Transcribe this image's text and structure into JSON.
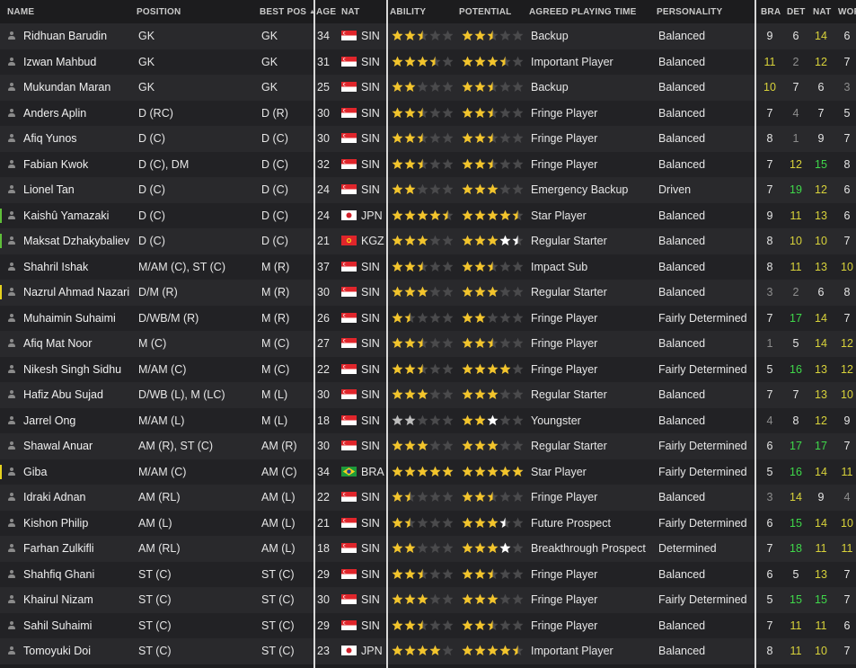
{
  "headers": {
    "name": "NAME",
    "position": "POSITION",
    "best_pos": "BEST POS",
    "age": "AGE",
    "nat": "NAT",
    "ability": "ABILITY",
    "potential": "POTENTIAL",
    "agreed_playing_time": "AGREED PLAYING TIME",
    "personality": "PERSONALITY",
    "bra": "BRA",
    "det": "DET",
    "nat_attr": "NAT",
    "wor": "WOR"
  },
  "colors": {
    "star_gold": "#f2c42c",
    "star_white": "#ffffff",
    "star_silver": "#bdbdbd",
    "star_empty": "#4a4a4c",
    "attr_default": "#e6e6e6",
    "attr_low": "#8e8e8e",
    "attr_mid": "#d8d23a",
    "attr_high": "#3fd84a",
    "marker_green": "#5fbf3a",
    "marker_yellow": "#e6d21e"
  },
  "players": [
    {
      "name": "Ridhuan Barudin",
      "position": "GK",
      "best_pos": "GK",
      "age": "34",
      "nat": "SIN",
      "ability": 2.5,
      "ability_color": "gold",
      "potential": 2.5,
      "potential_color": "gold",
      "time": "Backup",
      "personality": "Balanced",
      "attrs": [
        "9",
        "6",
        "14",
        "6"
      ],
      "attr_tone": [
        "n",
        "n",
        "m",
        "n"
      ],
      "marker": ""
    },
    {
      "name": "Izwan Mahbud",
      "position": "GK",
      "best_pos": "GK",
      "age": "31",
      "nat": "SIN",
      "ability": 3.5,
      "ability_color": "gold",
      "potential": 3.5,
      "potential_color": "gold",
      "time": "Important Player",
      "personality": "Balanced",
      "attrs": [
        "11",
        "2",
        "12",
        "7"
      ],
      "attr_tone": [
        "m",
        "l",
        "m",
        "n"
      ],
      "marker": ""
    },
    {
      "name": "Mukundan Maran",
      "position": "GK",
      "best_pos": "GK",
      "age": "25",
      "nat": "SIN",
      "ability": 2,
      "ability_color": "gold",
      "potential": 2.5,
      "potential_color": "gold",
      "time": "Backup",
      "personality": "Balanced",
      "attrs": [
        "10",
        "7",
        "6",
        "3"
      ],
      "attr_tone": [
        "m",
        "n",
        "n",
        "l"
      ],
      "marker": ""
    },
    {
      "name": "Anders Aplin",
      "position": "D (RC)",
      "best_pos": "D (R)",
      "age": "30",
      "nat": "SIN",
      "ability": 2.5,
      "ability_color": "gold",
      "potential": 2.5,
      "potential_color": "gold",
      "time": "Fringe Player",
      "personality": "Balanced",
      "attrs": [
        "7",
        "4",
        "7",
        "5"
      ],
      "attr_tone": [
        "n",
        "l",
        "n",
        "n"
      ],
      "marker": ""
    },
    {
      "name": "Afiq Yunos",
      "position": "D (C)",
      "best_pos": "D (C)",
      "age": "30",
      "nat": "SIN",
      "ability": 2.5,
      "ability_color": "gold",
      "potential": 2.5,
      "potential_color": "gold",
      "time": "Fringe Player",
      "personality": "Balanced",
      "attrs": [
        "8",
        "1",
        "9",
        "7"
      ],
      "attr_tone": [
        "n",
        "l",
        "n",
        "n"
      ],
      "marker": ""
    },
    {
      "name": "Fabian Kwok",
      "position": "D (C), DM",
      "best_pos": "D (C)",
      "age": "32",
      "nat": "SIN",
      "ability": 2.5,
      "ability_color": "gold",
      "potential": 2.5,
      "potential_color": "gold",
      "time": "Fringe Player",
      "personality": "Balanced",
      "attrs": [
        "7",
        "12",
        "15",
        "8"
      ],
      "attr_tone": [
        "n",
        "m",
        "h",
        "n"
      ],
      "marker": ""
    },
    {
      "name": "Lionel Tan",
      "position": "D (C)",
      "best_pos": "D (C)",
      "age": "24",
      "nat": "SIN",
      "ability": 2,
      "ability_color": "gold",
      "potential": 3,
      "potential_color": "gold",
      "time": "Emergency Backup",
      "personality": "Driven",
      "attrs": [
        "7",
        "19",
        "12",
        "6"
      ],
      "attr_tone": [
        "n",
        "h",
        "m",
        "n"
      ],
      "marker": ""
    },
    {
      "name": "Kaishû Yamazaki",
      "position": "D (C)",
      "best_pos": "D (C)",
      "age": "24",
      "nat": "JPN",
      "ability": 4.5,
      "ability_color": "gold",
      "potential": 4.5,
      "potential_color": "gold",
      "time": "Star Player",
      "personality": "Balanced",
      "attrs": [
        "9",
        "11",
        "13",
        "6"
      ],
      "attr_tone": [
        "n",
        "m",
        "m",
        "n"
      ],
      "marker": "green"
    },
    {
      "name": "Maksat Dzhakybaliev",
      "position": "D (C)",
      "best_pos": "D (C)",
      "age": "21",
      "nat": "KGZ",
      "ability": 3,
      "ability_color": "gold",
      "potential": 4.5,
      "potential_color": "white",
      "potential_gold": 3,
      "time": "Regular Starter",
      "personality": "Balanced",
      "attrs": [
        "8",
        "10",
        "10",
        "7"
      ],
      "attr_tone": [
        "n",
        "m",
        "m",
        "n"
      ],
      "marker": "green"
    },
    {
      "name": "Shahril Ishak",
      "position": "M/AM (C), ST (C)",
      "best_pos": "M (R)",
      "age": "37",
      "nat": "SIN",
      "ability": 2.5,
      "ability_color": "gold",
      "potential": 2.5,
      "potential_color": "gold",
      "time": "Impact Sub",
      "personality": "Balanced",
      "attrs": [
        "8",
        "11",
        "13",
        "10"
      ],
      "attr_tone": [
        "n",
        "m",
        "m",
        "m"
      ],
      "marker": ""
    },
    {
      "name": "Nazrul Ahmad Nazari",
      "position": "D/M (R)",
      "best_pos": "M (R)",
      "age": "30",
      "nat": "SIN",
      "ability": 3,
      "ability_color": "gold",
      "potential": 3,
      "potential_color": "gold",
      "time": "Regular Starter",
      "personality": "Balanced",
      "attrs": [
        "3",
        "2",
        "6",
        "8"
      ],
      "attr_tone": [
        "l",
        "l",
        "n",
        "n"
      ],
      "marker": "yellow"
    },
    {
      "name": "Muhaimin Suhaimi",
      "position": "D/WB/M (R)",
      "best_pos": "M (R)",
      "age": "26",
      "nat": "SIN",
      "ability": 1.5,
      "ability_color": "gold",
      "potential": 2,
      "potential_color": "gold",
      "time": "Fringe Player",
      "personality": "Fairly Determined",
      "attrs": [
        "7",
        "17",
        "14",
        "7"
      ],
      "attr_tone": [
        "n",
        "h",
        "m",
        "n"
      ],
      "marker": ""
    },
    {
      "name": "Afiq Mat Noor",
      "position": "M (C)",
      "best_pos": "M (C)",
      "age": "27",
      "nat": "SIN",
      "ability": 2.5,
      "ability_color": "gold",
      "potential": 2.5,
      "potential_color": "gold",
      "time": "Fringe Player",
      "personality": "Balanced",
      "attrs": [
        "1",
        "5",
        "14",
        "12"
      ],
      "attr_tone": [
        "l",
        "n",
        "m",
        "m"
      ],
      "marker": ""
    },
    {
      "name": "Nikesh Singh Sidhu",
      "position": "M/AM (C)",
      "best_pos": "M (C)",
      "age": "22",
      "nat": "SIN",
      "ability": 2.5,
      "ability_color": "gold",
      "potential": 4,
      "potential_color": "gold",
      "time": "Fringe Player",
      "personality": "Fairly Determined",
      "attrs": [
        "5",
        "16",
        "13",
        "12"
      ],
      "attr_tone": [
        "n",
        "h",
        "m",
        "m"
      ],
      "marker": ""
    },
    {
      "name": "Hafiz Abu Sujad",
      "position": "D/WB (L), M (LC)",
      "best_pos": "M (L)",
      "age": "30",
      "nat": "SIN",
      "ability": 3,
      "ability_color": "gold",
      "potential": 3,
      "potential_color": "gold",
      "time": "Regular Starter",
      "personality": "Balanced",
      "attrs": [
        "7",
        "7",
        "13",
        "10"
      ],
      "attr_tone": [
        "n",
        "n",
        "m",
        "m"
      ],
      "marker": ""
    },
    {
      "name": "Jarrel Ong",
      "position": "M/AM (L)",
      "best_pos": "M (L)",
      "age": "18",
      "nat": "SIN",
      "ability": 2,
      "ability_color": "silver",
      "potential": 3,
      "potential_color": "white",
      "potential_gold": 2,
      "time": "Youngster",
      "personality": "Balanced",
      "attrs": [
        "4",
        "8",
        "12",
        "9"
      ],
      "attr_tone": [
        "l",
        "n",
        "m",
        "n"
      ],
      "marker": ""
    },
    {
      "name": "Shawal Anuar",
      "position": "AM (R), ST (C)",
      "best_pos": "AM (R)",
      "age": "30",
      "nat": "SIN",
      "ability": 3,
      "ability_color": "gold",
      "potential": 3,
      "potential_color": "gold",
      "time": "Regular Starter",
      "personality": "Fairly Determined",
      "attrs": [
        "6",
        "17",
        "17",
        "7"
      ],
      "attr_tone": [
        "n",
        "h",
        "h",
        "n"
      ],
      "marker": ""
    },
    {
      "name": "Giba",
      "position": "M/AM (C)",
      "best_pos": "AM (C)",
      "age": "34",
      "nat": "BRA",
      "ability": 5,
      "ability_color": "gold",
      "potential": 5,
      "potential_color": "gold",
      "time": "Star Player",
      "personality": "Fairly Determined",
      "attrs": [
        "5",
        "16",
        "14",
        "11"
      ],
      "attr_tone": [
        "n",
        "h",
        "m",
        "m"
      ],
      "marker": "yellow"
    },
    {
      "name": "Idraki Adnan",
      "position": "AM (RL)",
      "best_pos": "AM (L)",
      "age": "22",
      "nat": "SIN",
      "ability": 1.5,
      "ability_color": "gold",
      "potential": 2.5,
      "potential_color": "gold",
      "time": "Fringe Player",
      "personality": "Balanced",
      "attrs": [
        "3",
        "14",
        "9",
        "4"
      ],
      "attr_tone": [
        "l",
        "m",
        "n",
        "l"
      ],
      "marker": ""
    },
    {
      "name": "Kishon Philip",
      "position": "AM (L)",
      "best_pos": "AM (L)",
      "age": "21",
      "nat": "SIN",
      "ability": 1.5,
      "ability_color": "gold",
      "potential": 3.5,
      "potential_color": "white",
      "potential_gold": 3,
      "time": "Future Prospect",
      "personality": "Fairly Determined",
      "attrs": [
        "6",
        "15",
        "14",
        "10"
      ],
      "attr_tone": [
        "n",
        "h",
        "m",
        "m"
      ],
      "marker": ""
    },
    {
      "name": "Farhan Zulkifli",
      "position": "AM (RL)",
      "best_pos": "AM (L)",
      "age": "18",
      "nat": "SIN",
      "ability": 2,
      "ability_color": "gold",
      "potential": 4,
      "potential_color": "white",
      "potential_gold": 3,
      "time": "Breakthrough Prospect",
      "personality": "Determined",
      "attrs": [
        "7",
        "18",
        "11",
        "11"
      ],
      "attr_tone": [
        "n",
        "h",
        "m",
        "m"
      ],
      "marker": ""
    },
    {
      "name": "Shahfiq Ghani",
      "position": "ST (C)",
      "best_pos": "ST (C)",
      "age": "29",
      "nat": "SIN",
      "ability": 2.5,
      "ability_color": "gold",
      "potential": 2.5,
      "potential_color": "gold",
      "time": "Fringe Player",
      "personality": "Balanced",
      "attrs": [
        "6",
        "5",
        "13",
        "7"
      ],
      "attr_tone": [
        "n",
        "n",
        "m",
        "n"
      ],
      "marker": ""
    },
    {
      "name": "Khairul Nizam",
      "position": "ST (C)",
      "best_pos": "ST (C)",
      "age": "30",
      "nat": "SIN",
      "ability": 3,
      "ability_color": "gold",
      "potential": 3,
      "potential_color": "gold",
      "time": "Fringe Player",
      "personality": "Fairly Determined",
      "attrs": [
        "5",
        "15",
        "15",
        "7"
      ],
      "attr_tone": [
        "n",
        "h",
        "h",
        "n"
      ],
      "marker": ""
    },
    {
      "name": "Sahil Suhaimi",
      "position": "ST (C)",
      "best_pos": "ST (C)",
      "age": "29",
      "nat": "SIN",
      "ability": 2.5,
      "ability_color": "gold",
      "potential": 2.5,
      "potential_color": "gold",
      "time": "Fringe Player",
      "personality": "Balanced",
      "attrs": [
        "7",
        "11",
        "11",
        "6"
      ],
      "attr_tone": [
        "n",
        "m",
        "m",
        "n"
      ],
      "marker": ""
    },
    {
      "name": "Tomoyuki Doi",
      "position": "ST (C)",
      "best_pos": "ST (C)",
      "age": "23",
      "nat": "JPN",
      "ability": 4,
      "ability_color": "gold",
      "potential": 4.5,
      "potential_color": "gold",
      "time": "Important Player",
      "personality": "Balanced",
      "attrs": [
        "8",
        "11",
        "10",
        "7"
      ],
      "attr_tone": [
        "n",
        "m",
        "m",
        "n"
      ],
      "marker": ""
    }
  ]
}
